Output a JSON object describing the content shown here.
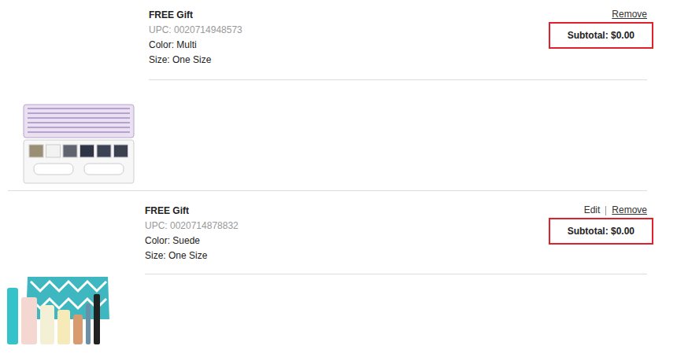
{
  "items": [
    {
      "title": "FREE Gift",
      "upc": "UPC: 0020714948573",
      "color": "Color: Multi",
      "size": "Size: One Size",
      "actions": [
        "Remove"
      ],
      "subtotal": "Subtotal: $0.00",
      "highlighted": true,
      "kind": "palette"
    },
    {
      "title": "FREE Gift",
      "upc": "UPC: 0020714878832",
      "color": "Color: Suede",
      "size": "Size: One Size",
      "actions": [
        "Edit",
        "Remove"
      ],
      "subtotal": "Subtotal: $0.00",
      "highlighted": true,
      "kind": "bag"
    }
  ]
}
